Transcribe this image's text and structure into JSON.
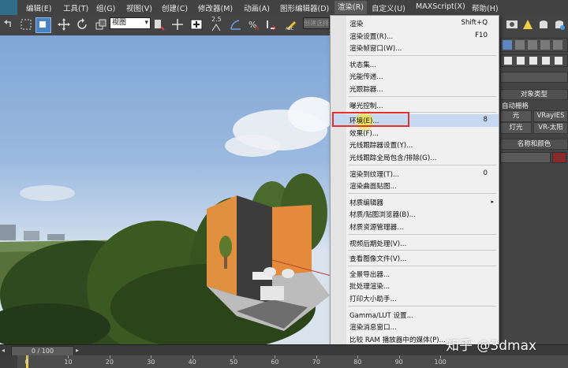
{
  "menubar": {
    "items": [
      {
        "label": "编辑(E)"
      },
      {
        "label": "工具(T)"
      },
      {
        "label": "组(G)"
      },
      {
        "label": "视图(V)"
      },
      {
        "label": "创建(C)"
      },
      {
        "label": "修改器(M)"
      },
      {
        "label": "动画(A)"
      },
      {
        "label": "图形编辑器(D)"
      },
      {
        "label": "渲染(R)"
      },
      {
        "label": "自定义(U)"
      },
      {
        "label": "MAXScript(X)"
      },
      {
        "label": "帮助(H)"
      }
    ]
  },
  "toolbar": {
    "view_select": "视图",
    "snap_value": "2.5",
    "selection_set_placeholder": "创建选择集"
  },
  "render_menu": {
    "items": [
      {
        "label": "渲染",
        "shortcut": "Shift+Q"
      },
      {
        "label": "渲染设置(R)...",
        "shortcut": "F10"
      },
      {
        "label": "渲染帧窗口(W)...",
        "shortcut": ""
      },
      {
        "label": "状态集...",
        "shortcut": ""
      },
      {
        "label": "光能传递...",
        "shortcut": ""
      },
      {
        "label": "光跟踪器...",
        "shortcut": ""
      },
      {
        "label": "曝光控制...",
        "shortcut": ""
      },
      {
        "label": "环境(E)...",
        "shortcut": "8"
      },
      {
        "label": "效果(F)...",
        "shortcut": ""
      },
      {
        "label": "光线跟踪器设置(Y)...",
        "shortcut": ""
      },
      {
        "label": "光线跟踪全局包含/排除(G)...",
        "shortcut": ""
      },
      {
        "label": "渲染到纹理(T)...",
        "shortcut": "0"
      },
      {
        "label": "渲染曲面贴图...",
        "shortcut": ""
      },
      {
        "label": "材质编辑器",
        "shortcut": "▸"
      },
      {
        "label": "材质/贴图浏览器(B)...",
        "shortcut": ""
      },
      {
        "label": "材质资源管理器...",
        "shortcut": ""
      },
      {
        "label": "视频后期处理(V)...",
        "shortcut": ""
      },
      {
        "label": "查看图像文件(V)...",
        "shortcut": ""
      },
      {
        "label": "全景导出器...",
        "shortcut": ""
      },
      {
        "label": "批处理渲染...",
        "shortcut": ""
      },
      {
        "label": "打印大小助手...",
        "shortcut": ""
      },
      {
        "label": "Gamma/LUT 设置...",
        "shortcut": ""
      },
      {
        "label": "渲染消息窗口...",
        "shortcut": ""
      },
      {
        "label": "比较 RAM 播放器中的媒体(P)...",
        "shortcut": ""
      }
    ],
    "highlighted_item": "环境(E)..."
  },
  "command_panel": {
    "object_type_header": "对象类型",
    "autogrid_label": "自动栅格",
    "buttons": [
      {
        "label": "光"
      },
      {
        "label": "VRayIES"
      },
      {
        "label": "灯光"
      },
      {
        "label": "VR-太阳"
      }
    ],
    "name_color_header": "名称和颜色"
  },
  "timeline": {
    "frame_counter": "0 / 100",
    "ticks": [
      "0",
      "10",
      "20",
      "30",
      "40",
      "50",
      "60",
      "70",
      "80",
      "90",
      "100"
    ]
  },
  "watermark": "知乎 @3dmax",
  "colors": {
    "menu_bg": "#f0f0f0",
    "highlight_box": "#e03030",
    "highlight_fill": "#c6d9f1",
    "cursor_glow": "#f2e63a",
    "toolbar_bg": "#444444"
  }
}
